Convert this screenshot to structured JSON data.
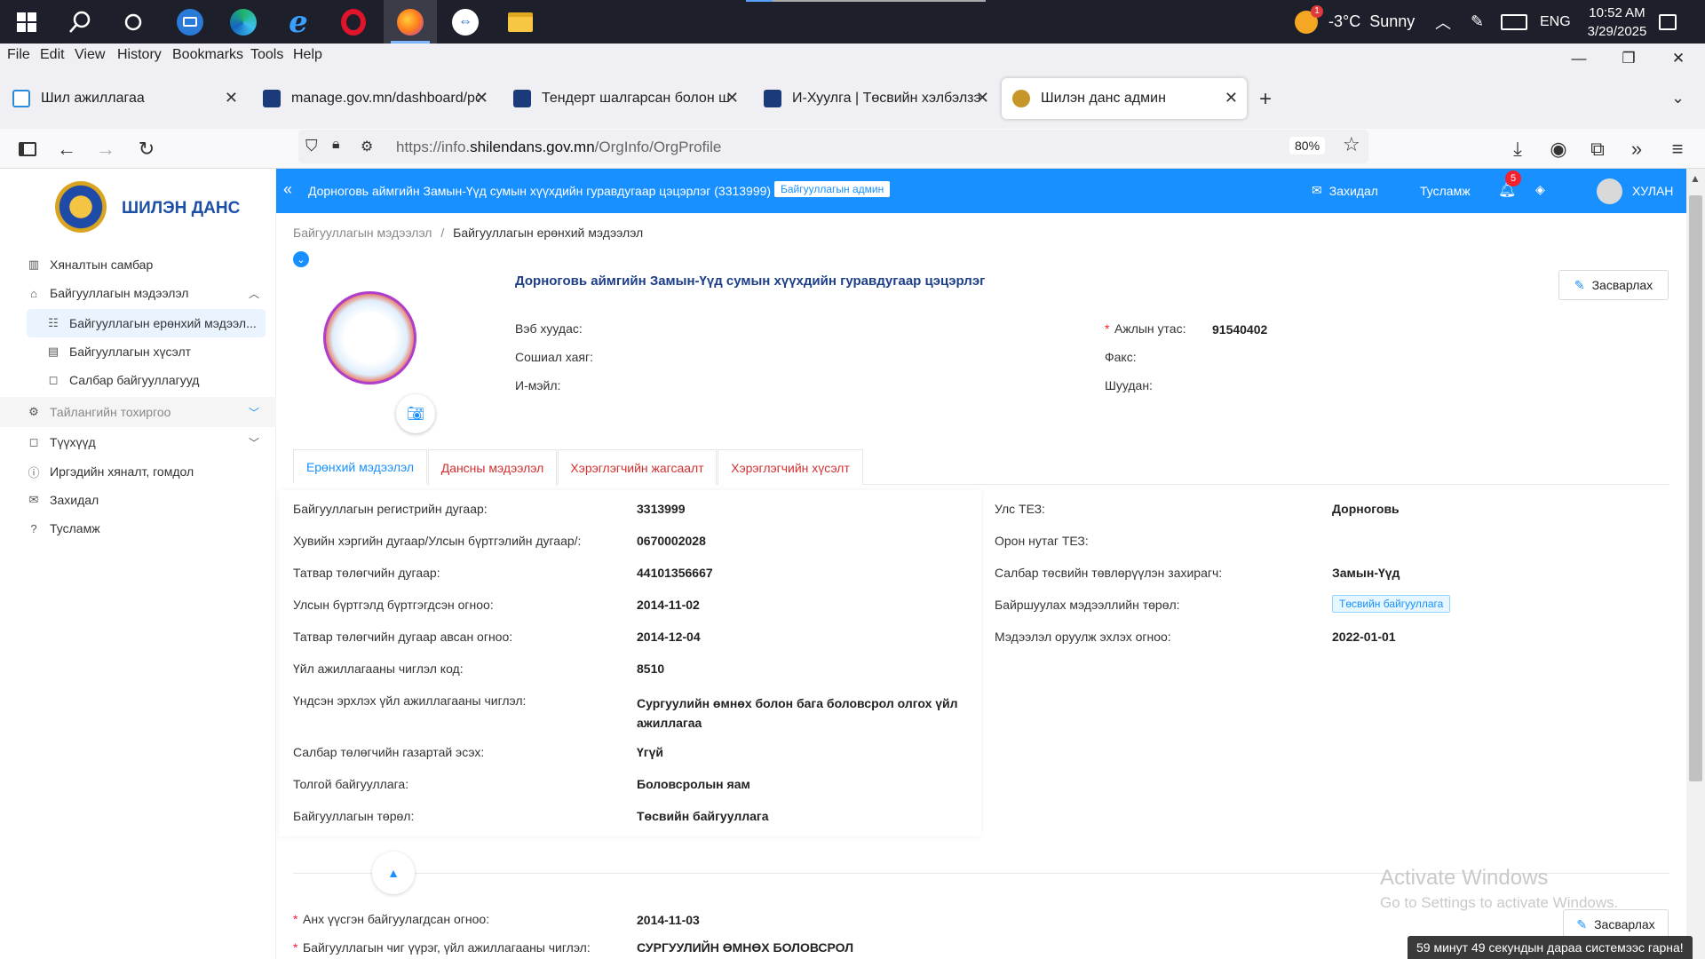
{
  "taskbar": {
    "icons": [
      "windows-start-icon",
      "search-icon",
      "task-view-icon",
      "remote-desktop-icon",
      "edge-icon",
      "internet-explorer-icon",
      "opera-icon",
      "firefox-icon",
      "teamviewer-icon",
      "file-explorer-icon"
    ],
    "weather_badge": "1",
    "weather_text": "-3°C  Sunny",
    "language": "ENG",
    "time": "10:52 AM",
    "date": "3/29/2025"
  },
  "menubar": {
    "items": [
      "File",
      "Edit",
      "View",
      "History",
      "Bookmarks",
      "Tools",
      "Help"
    ]
  },
  "tabs": [
    {
      "title": "Шил ажиллагаа",
      "active": false
    },
    {
      "title": "manage.gov.mn/dashboard/pos",
      "active": false
    },
    {
      "title": "Тендерт шалгарсан болон шал",
      "active": false
    },
    {
      "title": "И-Хуулга | Төсвийн хэлбэлзэл",
      "active": false
    },
    {
      "title": "Шилэн данс админ",
      "active": true
    }
  ],
  "navbar": {
    "url_prefix": "https://info.",
    "url_domain": "shilendans.gov.mn",
    "url_path": "/OrgInfo/OrgProfile",
    "zoom": "80%"
  },
  "sidebar": {
    "brand": "ШИЛЭН ДАНС",
    "items": [
      {
        "label": "Хяналтын самбар",
        "icon": "chart-icon"
      },
      {
        "label": "Байгууллагын мэдээлэл",
        "icon": "home-icon"
      },
      {
        "label": "Байгууллагын ерөнхий мэдээл...",
        "icon": "table-icon"
      },
      {
        "label": "Байгууллагын хүсэлт",
        "icon": "document-icon"
      },
      {
        "label": "Салбар байгууллагууд",
        "icon": "square-icon"
      },
      {
        "label": "Тайлангийн тохиргоо",
        "icon": "gear-icon"
      },
      {
        "label": "Түүхүүд",
        "icon": "square-icon"
      },
      {
        "label": "Иргэдийн хяналт, гомдол",
        "icon": "info-icon"
      },
      {
        "label": "Захидал",
        "icon": "mail-icon"
      },
      {
        "label": "Тусламж",
        "icon": "question-icon"
      }
    ]
  },
  "appbar": {
    "org_title": "Дорноговь аймгийн Замын-Үүд сумын хүүхдийн гуравдугаар цэцэрлэг (3313999)",
    "role_badge": "Байгууллагын админ",
    "mail": "Захидал",
    "help": "Тусламж",
    "notif_count": "5",
    "user": "ХУЛАН"
  },
  "breadcrumb": {
    "parent": "Байгууллагын мэдээлэл",
    "separator": "/",
    "current": "Байгууллагын ерөнхий мэдээлэл"
  },
  "profile": {
    "name": "Дорноговь аймгийн Замын-Үүд сумын хүүхдийн гуравдугаар цэцэрлэг",
    "edit": "Засварлах",
    "website_label": "Вэб хуудас:",
    "social_label": "Сошиал хаяг:",
    "email_label": "И-мэйл:",
    "phone_required": "*",
    "phone_label": "Ажлын утас:",
    "phone_value": "91540402",
    "fax_label": "Факс:",
    "post_label": "Шуудан:"
  },
  "content_tabs": [
    "Ерөнхий мэдээлэл",
    "Дансны мэдээлэл",
    "Хэрэглэгчийн жагсаалт",
    "Хэрэглэгчийн хүсэлт"
  ],
  "left_fields": [
    {
      "label": "Байгууллагын регистрийн дугаар:",
      "value": "3313999"
    },
    {
      "label": "Хувийн хэргийн дугаар/Улсын бүртгэлийн дугаар/:",
      "value": "0670002028"
    },
    {
      "label": "Татвар төлөгчийн дугаар:",
      "value": "44101356667"
    },
    {
      "label": "Улсын бүртгэлд бүртгэгдсэн огноо:",
      "value": "2014-11-02"
    },
    {
      "label": "Татвар төлөгчийн дугаар авсан огноо:",
      "value": "2014-12-04"
    },
    {
      "label": "Үйл ажиллагааны чиглэл код:",
      "value": "8510"
    },
    {
      "label": "Үндсэн эрхлэх үйл ажиллагааны чиглэл:",
      "value": "Сургуулийн өмнөх болон бага боловсрол олгох үйл ажиллагаа"
    },
    {
      "label": "Салбар төлөгчийн газартай эсэх:",
      "value": "Үгүй"
    },
    {
      "label": "Толгой байгууллага:",
      "value": "Боловсролын яам"
    },
    {
      "label": "Байгууллагын төрөл:",
      "value": "Төсвийн байгууллага"
    }
  ],
  "right_fields": [
    {
      "label": "Улс ТЕЗ:",
      "value": "Дорноговь"
    },
    {
      "label": "Орон нутаг ТЕЗ:",
      "value": ""
    },
    {
      "label": "Салбар төсвийн төвлөрүүлэн захирагч:",
      "value": "Замын-Үүд"
    },
    {
      "label": "Байршуулах мэдээллийн төрөл:",
      "value": "Төсвийн байгууллага"
    },
    {
      "label": "Мэдээлэл оруулж эхлэх огноо:",
      "value": "2022-01-01"
    }
  ],
  "lower": {
    "founded_required": "*",
    "founded_label": "Анх үүсгэн байгуулагдсан огноо:",
    "founded_value": "2014-11-03",
    "purpose_required": "*",
    "purpose_label": "Байгууллагын чиг үүрэг, үйл ажиллагааны чиглэл:",
    "purpose_value": "СУРГУУЛИЙН ӨМНӨХ БОЛОВСРОЛ",
    "edit": "Засварлах"
  },
  "watermark": {
    "line1": "Activate Windows",
    "line2": "Go to Settings to activate Windows."
  },
  "session_notice": "59 минут 49 секундын дараа системээс гарна!",
  "colors": {
    "primary": "#1890ff",
    "danger": "#d32f2f",
    "taskbar": "#1d1f2a"
  }
}
